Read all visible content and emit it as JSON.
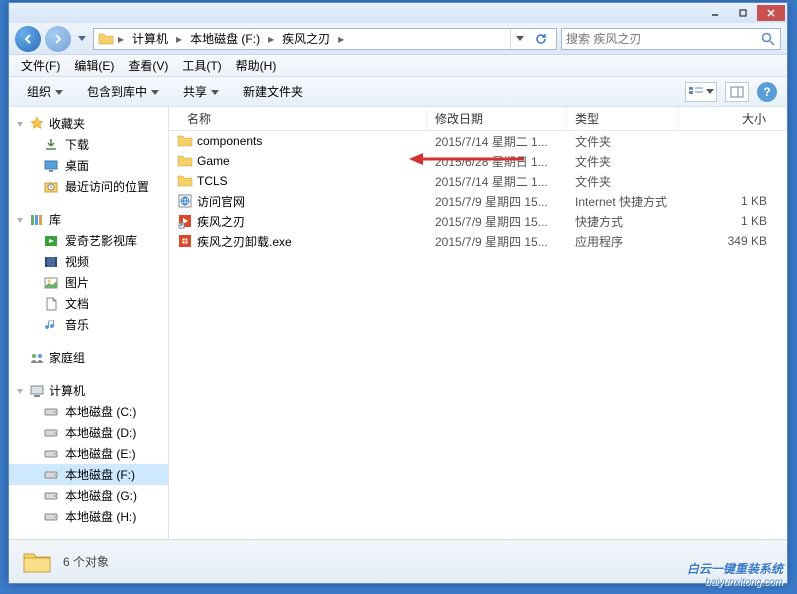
{
  "titlebar": {},
  "nav": {
    "breadcrumbs": [
      "计算机",
      "本地磁盘 (F:)",
      "疾风之刃"
    ],
    "search_placeholder": "搜索 疾风之刃"
  },
  "menubar": {
    "items": [
      "文件(F)",
      "编辑(E)",
      "查看(V)",
      "工具(T)",
      "帮助(H)"
    ]
  },
  "toolbar": {
    "organize": "组织",
    "include": "包含到库中",
    "share": "共享",
    "newfolder": "新建文件夹"
  },
  "sidebar": {
    "favorites": {
      "label": "收藏夹",
      "items": [
        "下载",
        "桌面",
        "最近访问的位置"
      ]
    },
    "libraries": {
      "label": "库",
      "items": [
        "爱奇艺影视库",
        "视频",
        "图片",
        "文档",
        "音乐"
      ]
    },
    "homegroup": {
      "label": "家庭组"
    },
    "computer": {
      "label": "计算机",
      "items": [
        "本地磁盘 (C:)",
        "本地磁盘 (D:)",
        "本地磁盘 (E:)",
        "本地磁盘 (F:)",
        "本地磁盘 (G:)",
        "本地磁盘 (H:)"
      ]
    }
  },
  "columns": {
    "name": "名称",
    "date": "修改日期",
    "type": "类型",
    "size": "大小"
  },
  "files": [
    {
      "name": "components",
      "date": "2015/7/14 星期二 1...",
      "type": "文件夹",
      "size": "",
      "icon": "folder"
    },
    {
      "name": "Game",
      "date": "2015/6/28 星期日 1...",
      "type": "文件夹",
      "size": "",
      "icon": "folder"
    },
    {
      "name": "TCLS",
      "date": "2015/7/14 星期二 1...",
      "type": "文件夹",
      "size": "",
      "icon": "folder"
    },
    {
      "name": "访问官网",
      "date": "2015/7/9 星期四 15...",
      "type": "Internet 快捷方式",
      "size": "1 KB",
      "icon": "url"
    },
    {
      "name": "疾风之刃",
      "date": "2015/7/9 星期四 15...",
      "type": "快捷方式",
      "size": "1 KB",
      "icon": "shortcut"
    },
    {
      "name": "疾风之刃卸载.exe",
      "date": "2015/7/9 星期四 15...",
      "type": "应用程序",
      "size": "349 KB",
      "icon": "exe"
    }
  ],
  "status": {
    "count": "6 个对象"
  },
  "watermark": {
    "main": "白云一键重装系统",
    "sub": "baiyunxitong.com"
  }
}
